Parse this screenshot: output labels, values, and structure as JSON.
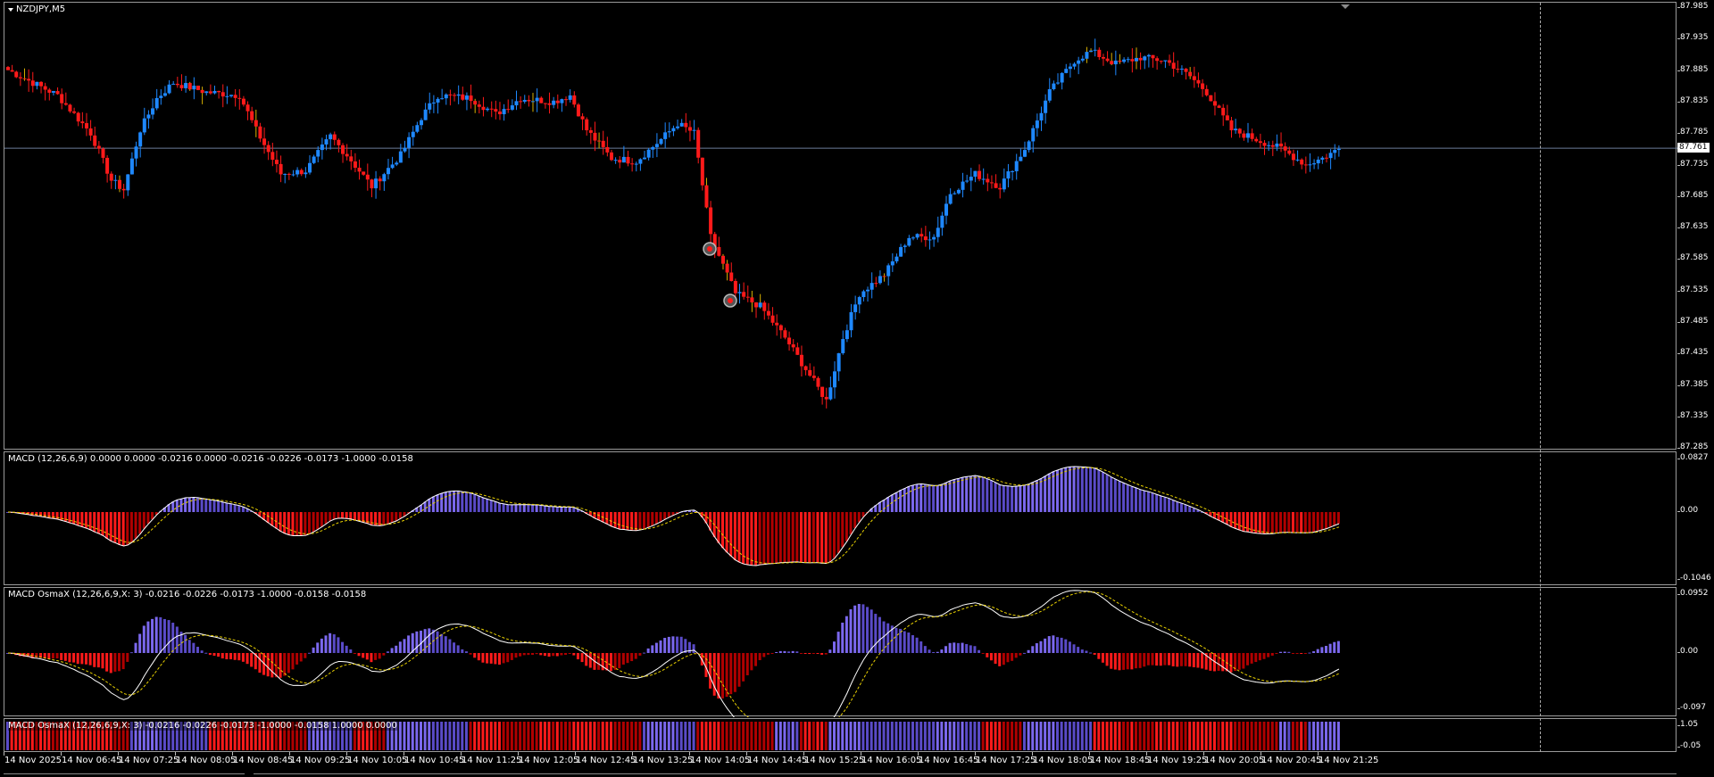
{
  "main": {
    "symbol": "NZDJPY,M5",
    "current_price": "87.761",
    "price_ticks": [
      "87.985",
      "87.935",
      "87.885",
      "87.835",
      "87.785",
      "87.735",
      "87.685",
      "87.635",
      "87.585",
      "87.535",
      "87.485",
      "87.435",
      "87.385",
      "87.335",
      "87.285"
    ],
    "bull_color": "#1e88ff",
    "bear_color": "#ff1a1a"
  },
  "macd": {
    "label": "MACD (12,26,6,9) 0.0000 0.0000 -0.0216 0.0000 -0.0216 -0.0226 -0.0173 -1.0000 -0.0158",
    "ticks": [
      "0.0827",
      "0.00",
      "-0.1046"
    ]
  },
  "osmax": {
    "label": "MACD OsmaX (12,26,6,9,X: 3) -0.0216 -0.0226 -0.0173 -1.0000 -0.0158 -0.0158",
    "ticks": [
      "0.0952",
      "0.00",
      "-0.097"
    ]
  },
  "osmax2": {
    "label": "MACD OsmaX (12,26,6,9,X: 3) -0.0216 -0.0226 -0.0173 -1.0000 -0.0158 1.0000 0.0000",
    "ticks": [
      "1.05",
      "-0.05"
    ]
  },
  "time_labels": [
    "14 Nov 2025",
    "14 Nov 06:45",
    "14 Nov 07:25",
    "14 Nov 08:05",
    "14 Nov 08:45",
    "14 Nov 09:25",
    "14 Nov 10:05",
    "14 Nov 10:45",
    "14 Nov 11:25",
    "14 Nov 12:05",
    "14 Nov 12:45",
    "14 Nov 13:25",
    "14 Nov 14:05",
    "14 Nov 14:45",
    "14 Nov 15:25",
    "14 Nov 16:05",
    "14 Nov 16:45",
    "14 Nov 17:25",
    "14 Nov 18:05",
    "14 Nov 18:45",
    "14 Nov 19:25",
    "14 Nov 20:05",
    "14 Nov 20:45",
    "14 Nov 21:25"
  ],
  "colors": {
    "pos_hist": "#7b68ee",
    "neg_hist": "#ff1a1a",
    "signal": "#e8d000",
    "macd_line": "#ffffff"
  },
  "icons": {
    "dropdown": "triangle-down-icon",
    "chart_shift": "shift-marker-icon",
    "arrow": "arrow-marker-icon"
  }
}
